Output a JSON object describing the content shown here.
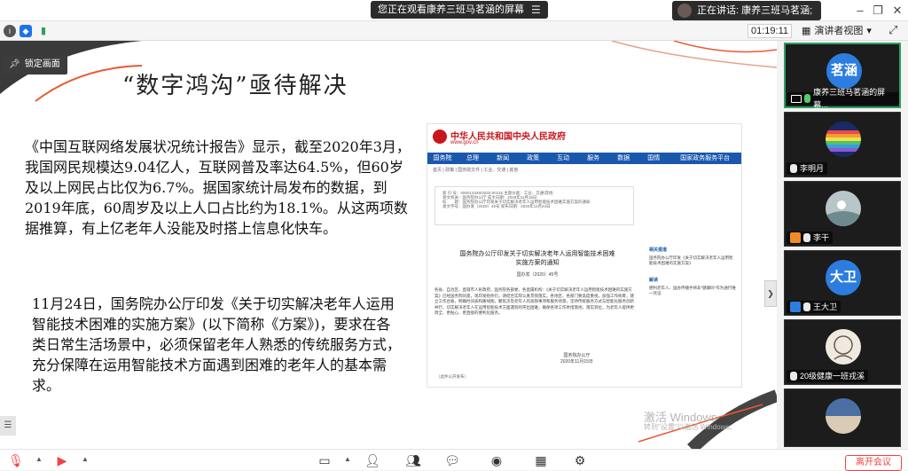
{
  "topbar": {
    "share_notice": "您正在观看康养三班马茗涵的屏幕",
    "speaking_notice": "正在讲话: 康养三班马茗涵;",
    "window_controls": [
      "minimize",
      "restore",
      "close"
    ]
  },
  "toolbar": {
    "timer": "01:19:11",
    "view_mode": "演讲者视图",
    "view_caret": "▾"
  },
  "slide": {
    "lock_label": "锁定画面",
    "title": "“数字鸿沟”亟待解决",
    "paragraph1": "《中国互联网络发展状况统计报告》显示，截至2020年3月，我国网民规模达9.04亿人，互联网普及率达64.5%，但60岁及以上网民占比仅为6.7%。据国家统计局发布的数据，到2019年底，60周岁及以上人口占比约为18.1%。从这两项数据推算，有上亿老年人没能及时搭上信息化快车。",
    "paragraph2": "11月24日，国务院办公厅印发《关于切实解决老年人运用智能技术困难的实施方案》(以下简称《方案》)，要求在各类日常生活场景中，必须保留老年人熟悉的传统服务方式，充分保障在运用智能技术方面遇到困难的老年人的基本需求。",
    "doc": {
      "site_name": "中华人民共和国中央人民政府",
      "site_url": "www.gov.cn",
      "nav": [
        "国务院",
        "总理",
        "新闻",
        "政策",
        "互动",
        "服务",
        "数据",
        "国情",
        "国家政务服务平台"
      ],
      "crumb": "首页 | 政策 | 国务院文件 | 工业、交通 | 其他",
      "meta": [
        "索 引 号：000014349/2020-00115    主题分类：工业、交通\\其他",
        "发文机关：国务院办公厅    成文日期：2020年11月15日",
        "标　　题：国务院办公厅印发关于切实解决老年人运用智能技术困难实施方案的通知",
        "发文字号：国办发〔2020〕45号    发布日期：2020年11月24日"
      ],
      "title": "国务院办公厅印发关于切实解决老年人运用智能技术困难实施方案的通知",
      "code": "国办发〔2020〕45号",
      "body": "各省、自治区、直辖市人民政府，国务院各部委、各直属机构：《关于切实解决老年人运用智能技术困难的实施方案》已经国务院同意，现印发给你们，请结合实际认真贯彻落实。各地区、各部门要高度重视，加强工作统筹，建立工作台账，明确时间表和路线图，聚焦涉及老年人的高频事项和服务场景，坚持传统服务方式与智能化服务创新并行，切实解决老年人在运用智能技术方面遇到的突出困难，确保各项工作举措落地，落实到位，为老年人提供更周全、更贴心、更直接的便利化服务。",
      "sign_org": "国务院办公厅",
      "sign_date": "2020年11月15日",
      "footer": "（此件公开发布）",
      "related_heading": "相关报道",
      "related_text": "国务院办公厅印发《关于切实解决老年人运用智能技术困难的实施方案》",
      "interp_heading": "解读",
      "interp_text": "便利老年人、国办传播手将非\"健康码\"作为通行唯一凭证"
    },
    "watermark_title": "激活 Windows",
    "watermark_sub": "转到\"设置\"以激活 Windows。"
  },
  "participants": [
    {
      "name": "康养三班马茗涵的屏幕...",
      "avatar_text": "茗涵",
      "avatar_color": "#2d7de0",
      "active": true
    },
    {
      "name": "李明月",
      "avatar_text": "",
      "avatar_color": "#2b3e8a",
      "active": false
    },
    {
      "name": "李干",
      "avatar_text": "",
      "avatar_color": "#8aa1a6",
      "active": false
    },
    {
      "name": "王大卫",
      "avatar_text": "大卫",
      "avatar_color": "#2d7de0",
      "active": false
    },
    {
      "name": "20级健康一班戎溪",
      "avatar_text": "",
      "avatar_color": "#e9e3dc",
      "active": false
    },
    {
      "name": "",
      "avatar_text": "",
      "avatar_color": "#4a6fa5",
      "active": false
    }
  ],
  "bottombar": {
    "leave_label": "离开会议"
  },
  "colors": {
    "accent_blue": "#2d7de0",
    "active_green": "#2aa15f",
    "gov_red": "#c8161d",
    "gov_nav_blue": "#1a58ae",
    "danger": "#e44444"
  }
}
